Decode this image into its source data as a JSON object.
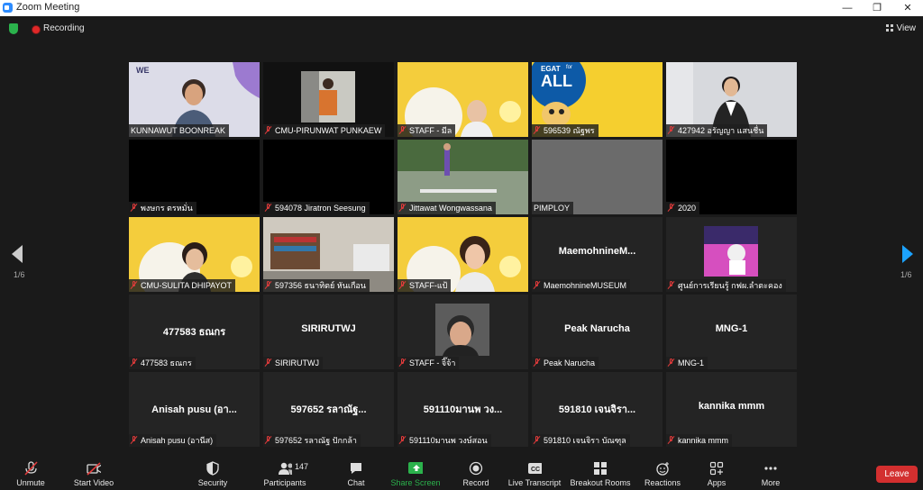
{
  "window": {
    "title": "Zoom Meeting",
    "controls": [
      "—",
      "❐",
      "✕"
    ]
  },
  "topbar": {
    "recording_label": "Recording",
    "view_label": "View"
  },
  "pagination": {
    "current": "1/6"
  },
  "tiles": [
    {
      "name": "KUNNAWUT BOONREAK",
      "big": "",
      "muted": false
    },
    {
      "name": "CMU-PIRUNWAT PUNKAEW",
      "big": "",
      "muted": true
    },
    {
      "name": "STAFF - มีล",
      "big": "",
      "muted": true
    },
    {
      "name": "596539 ณัฐพร",
      "big": "",
      "muted": true
    },
    {
      "name": "427942 อรัญญา แสนชื่น",
      "big": "",
      "muted": true
    },
    {
      "name": "พงษกร ตรหมั่น",
      "big": "",
      "muted": true
    },
    {
      "name": "594078 Jiratron Seesung",
      "big": "",
      "muted": true
    },
    {
      "name": "Jittawat Wongwassana",
      "big": "",
      "muted": true
    },
    {
      "name": "PIMPLOY",
      "big": "",
      "muted": false
    },
    {
      "name": "2020",
      "big": "",
      "muted": true
    },
    {
      "name": "CMU-SULITA DHIPAYOT",
      "big": "",
      "muted": true
    },
    {
      "name": "597356 ธนาทิตย์ หันเกือน",
      "big": "",
      "muted": true
    },
    {
      "name": "STAFF-แป้",
      "big": "",
      "muted": true
    },
    {
      "name": "MaemohnineMUSEUM",
      "big": "MaemohnineM...",
      "muted": true
    },
    {
      "name": "ศูนย์การเรียนรู้ กฟผ.ลำตะคอง",
      "big": "",
      "muted": true
    },
    {
      "name": "477583 ธณกร",
      "big": "477583 ธณกร",
      "muted": true
    },
    {
      "name": "SIRIRUTWJ",
      "big": "SIRIRUTWJ",
      "muted": true
    },
    {
      "name": "STAFF - จิ๊จ้า",
      "big": "",
      "muted": true
    },
    {
      "name": "Peak Narucha",
      "big": "Peak Narucha",
      "muted": true
    },
    {
      "name": "MNG-1",
      "big": "MNG-1",
      "muted": true
    },
    {
      "name": "Anisah  pusu (อานีส)",
      "big": "Anisah  pusu (อา...",
      "muted": true
    },
    {
      "name": "597652 รลาณัฐ ปักกล้า",
      "big": "597652 รลาณัฐ...",
      "muted": true
    },
    {
      "name": "591110มานพ วงษ์สอน",
      "big": "591110มานพ วง...",
      "muted": true
    },
    {
      "name": "591810 เจนจิรา บัณฑุล",
      "big": "591810 เจนจิรา...",
      "muted": true
    },
    {
      "name": "kannika mmm",
      "big": "kannika mmm",
      "muted": true
    }
  ],
  "tile_media": {
    "we_logo": "WE",
    "egat_line1": "EGAT",
    "egat_line2": "ALL",
    "egat_for": "for"
  },
  "toolbar": {
    "unmute": "Unmute",
    "start_video": "Start Video",
    "security": "Security",
    "participants": "Participants",
    "participant_count": "147",
    "chat": "Chat",
    "share_screen": "Share Screen",
    "record": "Record",
    "live_transcript": "Live Transcript",
    "breakout_rooms": "Breakout Rooms",
    "reactions": "Reactions",
    "apps": "Apps",
    "more": "More",
    "leave": "Leave",
    "cc": "CC"
  },
  "colors": {
    "active_speaker": "#b7e84b",
    "share_green": "#2bb24c",
    "leave_red": "#d32f2f",
    "accent_blue": "#1ca3ff"
  }
}
